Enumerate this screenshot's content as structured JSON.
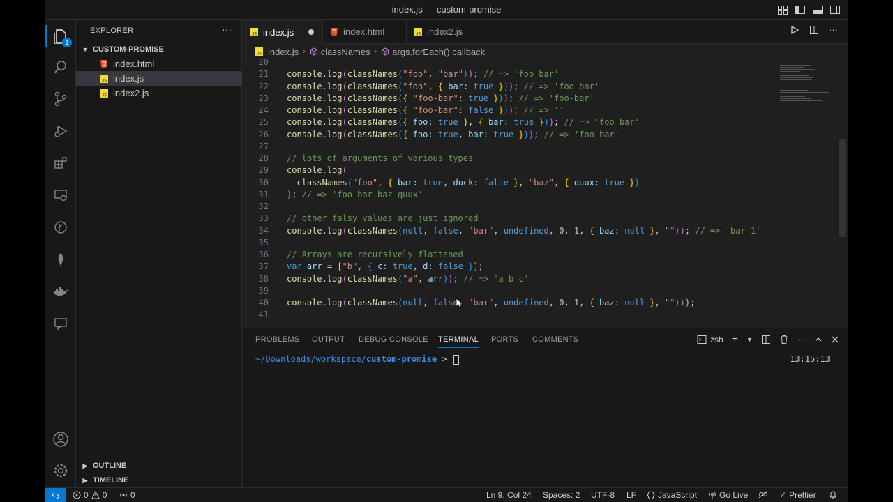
{
  "window": {
    "title": "index.js — custom-promise"
  },
  "activity": {
    "explorer_badge": "1"
  },
  "sidebar": {
    "header": "EXPLORER",
    "folder": "CUSTOM-PROMISE",
    "files": [
      {
        "name": "index.html",
        "type": "html"
      },
      {
        "name": "index.js",
        "type": "js"
      },
      {
        "name": "index2.js",
        "type": "js"
      }
    ],
    "outline": "OUTLINE",
    "timeline": "TIMELINE"
  },
  "tabs": [
    {
      "label": "index.js",
      "type": "js",
      "active": true,
      "dirty": true
    },
    {
      "label": "index.html",
      "type": "html",
      "active": false
    },
    {
      "label": "index2.js",
      "type": "js",
      "active": false
    }
  ],
  "breadcrumb": [
    "index.js",
    "classNames",
    "args.forEach() callback"
  ],
  "editor": {
    "lines": [
      {
        "n": "20",
        "tokens": []
      },
      {
        "n": "21",
        "tokens": [
          [
            "fn",
            "console"
          ],
          [
            "punct",
            "."
          ],
          [
            "fn",
            "log"
          ],
          [
            "paren",
            "("
          ],
          [
            "fn",
            "classNames"
          ],
          [
            "brace",
            "("
          ],
          [
            "str",
            "\"foo\""
          ],
          [
            "punct",
            ", "
          ],
          [
            "str",
            "\"bar\""
          ],
          [
            "brace",
            ")"
          ],
          [
            "paren",
            ")"
          ],
          [
            "punct",
            "; "
          ],
          [
            "comment",
            "// => 'foo bar'"
          ]
        ]
      },
      {
        "n": "22",
        "tokens": [
          [
            "fn",
            "console"
          ],
          [
            "punct",
            "."
          ],
          [
            "fn",
            "log"
          ],
          [
            "paren",
            "("
          ],
          [
            "fn",
            "classNames"
          ],
          [
            "brace",
            "("
          ],
          [
            "str",
            "\"foo\""
          ],
          [
            "punct",
            ", "
          ],
          [
            "bracket",
            "{ "
          ],
          [
            "key",
            "bar"
          ],
          [
            "punct",
            ": "
          ],
          [
            "bool",
            "true"
          ],
          [
            "bracket",
            " }"
          ],
          [
            "brace",
            ")"
          ],
          [
            "paren",
            ")"
          ],
          [
            "punct",
            "; "
          ],
          [
            "comment",
            "// => 'foo bar'"
          ]
        ]
      },
      {
        "n": "23",
        "tokens": [
          [
            "fn",
            "console"
          ],
          [
            "punct",
            "."
          ],
          [
            "fn",
            "log"
          ],
          [
            "paren",
            "("
          ],
          [
            "fn",
            "classNames"
          ],
          [
            "brace",
            "("
          ],
          [
            "bracket",
            "{ "
          ],
          [
            "str",
            "\"foo-bar\""
          ],
          [
            "punct",
            ": "
          ],
          [
            "bool",
            "true"
          ],
          [
            "bracket",
            " }"
          ],
          [
            "brace",
            ")"
          ],
          [
            "paren",
            ")"
          ],
          [
            "punct",
            "; "
          ],
          [
            "comment",
            "// => 'foo-bar'"
          ]
        ]
      },
      {
        "n": "24",
        "tokens": [
          [
            "fn",
            "console"
          ],
          [
            "punct",
            "."
          ],
          [
            "fn",
            "log"
          ],
          [
            "paren",
            "("
          ],
          [
            "fn",
            "classNames"
          ],
          [
            "brace",
            "("
          ],
          [
            "bracket",
            "{ "
          ],
          [
            "str",
            "\"foo-bar\""
          ],
          [
            "punct",
            ": "
          ],
          [
            "bool",
            "false"
          ],
          [
            "bracket",
            " }"
          ],
          [
            "brace",
            ")"
          ],
          [
            "paren",
            ")"
          ],
          [
            "punct",
            "; "
          ],
          [
            "comment",
            "// => ''"
          ]
        ]
      },
      {
        "n": "25",
        "tokens": [
          [
            "fn",
            "console"
          ],
          [
            "punct",
            "."
          ],
          [
            "fn",
            "log"
          ],
          [
            "paren",
            "("
          ],
          [
            "fn",
            "classNames"
          ],
          [
            "brace",
            "("
          ],
          [
            "bracket",
            "{ "
          ],
          [
            "key",
            "foo"
          ],
          [
            "punct",
            ": "
          ],
          [
            "bool",
            "true"
          ],
          [
            "bracket",
            " }"
          ],
          [
            "punct",
            ", "
          ],
          [
            "bracket",
            "{ "
          ],
          [
            "key",
            "bar"
          ],
          [
            "punct",
            ": "
          ],
          [
            "bool",
            "true"
          ],
          [
            "bracket",
            " }"
          ],
          [
            "brace",
            ")"
          ],
          [
            "paren",
            ")"
          ],
          [
            "punct",
            "; "
          ],
          [
            "comment",
            "// => 'foo bar'"
          ]
        ]
      },
      {
        "n": "26",
        "tokens": [
          [
            "fn",
            "console"
          ],
          [
            "punct",
            "."
          ],
          [
            "fn",
            "log"
          ],
          [
            "paren",
            "("
          ],
          [
            "fn",
            "classNames"
          ],
          [
            "brace",
            "("
          ],
          [
            "bracket",
            "{ "
          ],
          [
            "key",
            "foo"
          ],
          [
            "punct",
            ": "
          ],
          [
            "bool",
            "true"
          ],
          [
            "punct",
            ", "
          ],
          [
            "key",
            "bar"
          ],
          [
            "punct",
            ": "
          ],
          [
            "bool",
            "true"
          ],
          [
            "bracket",
            " }"
          ],
          [
            "brace",
            ")"
          ],
          [
            "paren",
            ")"
          ],
          [
            "punct",
            "; "
          ],
          [
            "comment",
            "// => 'foo bar'"
          ]
        ]
      },
      {
        "n": "27",
        "tokens": []
      },
      {
        "n": "28",
        "tokens": [
          [
            "comment",
            "// lots of arguments of various types"
          ]
        ]
      },
      {
        "n": "29",
        "tokens": [
          [
            "fn",
            "console"
          ],
          [
            "punct",
            "."
          ],
          [
            "fn",
            "log"
          ],
          [
            "paren",
            "("
          ]
        ]
      },
      {
        "n": "30",
        "tokens": [
          [
            "punct",
            "  "
          ],
          [
            "fn",
            "classNames"
          ],
          [
            "brace",
            "("
          ],
          [
            "str",
            "\"foo\""
          ],
          [
            "punct",
            ", "
          ],
          [
            "bracket",
            "{ "
          ],
          [
            "key",
            "bar"
          ],
          [
            "punct",
            ": "
          ],
          [
            "bool",
            "true"
          ],
          [
            "punct",
            ", "
          ],
          [
            "key",
            "duck"
          ],
          [
            "punct",
            ": "
          ],
          [
            "bool",
            "false"
          ],
          [
            "bracket",
            " }"
          ],
          [
            "punct",
            ", "
          ],
          [
            "str",
            "\"baz\""
          ],
          [
            "punct",
            ", "
          ],
          [
            "bracket",
            "{ "
          ],
          [
            "key",
            "quux"
          ],
          [
            "punct",
            ": "
          ],
          [
            "bool",
            "true"
          ],
          [
            "bracket",
            " }"
          ],
          [
            "brace",
            ")"
          ]
        ]
      },
      {
        "n": "31",
        "tokens": [
          [
            "paren",
            ")"
          ],
          [
            "punct",
            "; "
          ],
          [
            "comment",
            "// => 'foo bar baz quux'"
          ]
        ]
      },
      {
        "n": "32",
        "tokens": []
      },
      {
        "n": "33",
        "tokens": [
          [
            "comment",
            "// other falsy values are just ignored"
          ]
        ]
      },
      {
        "n": "34",
        "tokens": [
          [
            "fn",
            "console"
          ],
          [
            "punct",
            "."
          ],
          [
            "fn",
            "log"
          ],
          [
            "paren",
            "("
          ],
          [
            "fn",
            "classNames"
          ],
          [
            "brace",
            "("
          ],
          [
            "bool",
            "null"
          ],
          [
            "punct",
            ", "
          ],
          [
            "bool",
            "false"
          ],
          [
            "punct",
            ", "
          ],
          [
            "str",
            "\"bar\""
          ],
          [
            "punct",
            ", "
          ],
          [
            "bool",
            "undefined"
          ],
          [
            "punct",
            ", "
          ],
          [
            "num",
            "0"
          ],
          [
            "punct",
            ", "
          ],
          [
            "num",
            "1"
          ],
          [
            "punct",
            ", "
          ],
          [
            "bracket",
            "{ "
          ],
          [
            "key",
            "baz"
          ],
          [
            "punct",
            ": "
          ],
          [
            "bool",
            "null"
          ],
          [
            "bracket",
            " }"
          ],
          [
            "punct",
            ", "
          ],
          [
            "str",
            "\"\""
          ],
          [
            "brace",
            ")"
          ],
          [
            "paren",
            ")"
          ],
          [
            "punct",
            "; "
          ],
          [
            "comment",
            "// => 'bar 1'"
          ]
        ]
      },
      {
        "n": "35",
        "tokens": []
      },
      {
        "n": "36",
        "tokens": [
          [
            "comment",
            "// Arrays are recursively flattened"
          ]
        ]
      },
      {
        "n": "37",
        "tokens": [
          [
            "bool",
            "var"
          ],
          [
            "punct",
            " "
          ],
          [
            "key",
            "arr"
          ],
          [
            "punct",
            " = "
          ],
          [
            "bracket",
            "["
          ],
          [
            "str",
            "\"b\""
          ],
          [
            "punct",
            ", "
          ],
          [
            "brace",
            "{ "
          ],
          [
            "key",
            "c"
          ],
          [
            "punct",
            ": "
          ],
          [
            "bool",
            "true"
          ],
          [
            "punct",
            ", "
          ],
          [
            "key",
            "d"
          ],
          [
            "punct",
            ": "
          ],
          [
            "bool",
            "false"
          ],
          [
            "brace",
            " }"
          ],
          [
            "bracket",
            "]"
          ],
          [
            "punct",
            ";"
          ]
        ]
      },
      {
        "n": "38",
        "tokens": [
          [
            "fn",
            "console"
          ],
          [
            "punct",
            "."
          ],
          [
            "fn",
            "log"
          ],
          [
            "paren",
            "("
          ],
          [
            "fn",
            "classNames"
          ],
          [
            "brace",
            "("
          ],
          [
            "str",
            "\"a\""
          ],
          [
            "punct",
            ", "
          ],
          [
            "key",
            "arr"
          ],
          [
            "brace",
            ")"
          ],
          [
            "paren",
            ")"
          ],
          [
            "punct",
            "; "
          ],
          [
            "comment",
            "// => 'a b c'"
          ]
        ]
      },
      {
        "n": "39",
        "tokens": []
      },
      {
        "n": "40",
        "tokens": [
          [
            "fn",
            "console"
          ],
          [
            "punct",
            "."
          ],
          [
            "fn",
            "log"
          ],
          [
            "paren",
            "("
          ],
          [
            "fn",
            "classNames"
          ],
          [
            "brace",
            "("
          ],
          [
            "bool",
            "null"
          ],
          [
            "punct",
            ", "
          ],
          [
            "bool",
            "false"
          ],
          [
            "punct",
            ", "
          ],
          [
            "str",
            "\"bar\""
          ],
          [
            "punct",
            ", "
          ],
          [
            "bool",
            "undefined"
          ],
          [
            "punct",
            ", "
          ],
          [
            "num",
            "0"
          ],
          [
            "punct",
            ", "
          ],
          [
            "num",
            "1"
          ],
          [
            "punct",
            ", "
          ],
          [
            "bracket",
            "{ "
          ],
          [
            "key",
            "baz"
          ],
          [
            "punct",
            ": "
          ],
          [
            "bool",
            "null"
          ],
          [
            "bracket",
            " }"
          ],
          [
            "punct",
            ", "
          ],
          [
            "str",
            "\"\""
          ],
          [
            "brace",
            ")"
          ],
          [
            "paren",
            ")"
          ],
          [
            "punct",
            ");"
          ]
        ]
      },
      {
        "n": "41",
        "tokens": []
      }
    ]
  },
  "panel": {
    "tabs": [
      "PROBLEMS",
      "OUTPUT",
      "DEBUG CONSOLE",
      "TERMINAL",
      "PORTS",
      "COMMENTS"
    ],
    "active_tab": "TERMINAL",
    "shell": "zsh",
    "prompt_path": "~/Downloads/workspace/",
    "prompt_dir": "custom-promise",
    "prompt_symbol": " > ",
    "time": "13:15:13"
  },
  "status": {
    "errors": "0",
    "warnings": "0",
    "ports": "0",
    "position": "Ln 9, Col 24",
    "spaces": "Spaces: 2",
    "encoding": "UTF-8",
    "eol": "LF",
    "language": "JavaScript",
    "golive": "Go Live",
    "prettier": "Prettier"
  },
  "colors": {
    "accent": "#0078d4",
    "background": "#1f1f1f",
    "sidebar": "#181818"
  }
}
